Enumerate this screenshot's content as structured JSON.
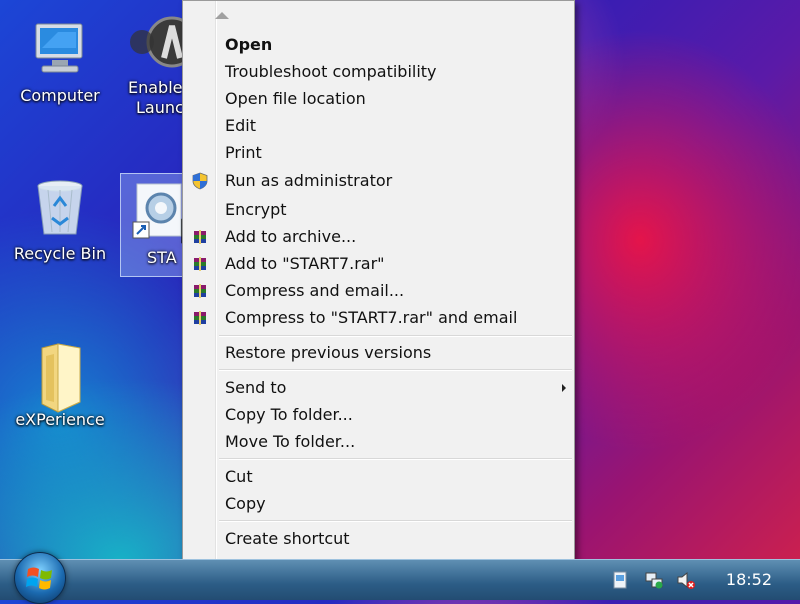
{
  "desktop": {
    "icons": [
      {
        "label": "Computer",
        "icon": "computer-icon"
      },
      {
        "label": "Enable\nLaunc",
        "icon": "launcher-icon"
      },
      {
        "label": "Recycle Bin",
        "icon": "recycle-bin-icon"
      },
      {
        "label": "STA",
        "icon": "shortcut-gear-icon"
      },
      {
        "label": "eXPerience",
        "icon": "folder-icon"
      }
    ]
  },
  "context_menu": {
    "items": [
      {
        "label": "Open",
        "bold": true
      },
      {
        "label": "Troubleshoot compatibility"
      },
      {
        "label": "Open file location"
      },
      {
        "label": "Edit"
      },
      {
        "label": "Print"
      },
      {
        "label": "Run as administrator",
        "icon": "uac-shield-icon"
      },
      {
        "label": "Encrypt"
      },
      {
        "label": "Add to archive...",
        "icon": "winrar-icon"
      },
      {
        "label": "Add to \"START7.rar\"",
        "icon": "winrar-icon"
      },
      {
        "label": "Compress and email...",
        "icon": "winrar-icon"
      },
      {
        "label": "Compress to \"START7.rar\" and email",
        "icon": "winrar-icon"
      },
      {
        "label": "Restore previous versions"
      },
      {
        "label": "Send to",
        "submenu": true
      },
      {
        "label": "Copy To folder..."
      },
      {
        "label": "Move To folder..."
      },
      {
        "label": "Cut"
      },
      {
        "label": "Copy"
      },
      {
        "label": "Create shortcut"
      }
    ]
  },
  "taskbar": {
    "clock": "18:52",
    "tray_icons": [
      "action-center-icon",
      "network-icon",
      "volume-muted-icon"
    ]
  },
  "colors": {
    "menu_bg": "#f1f1f1",
    "taskbar": "#2c5d86"
  }
}
